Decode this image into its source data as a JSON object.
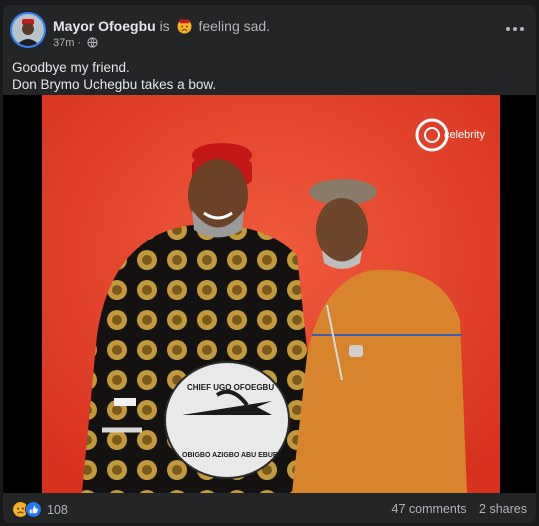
{
  "post": {
    "author": "Mayor Ofoegbu",
    "is_word": "is",
    "feeling": "feeling sad.",
    "time": "37m",
    "audience_icon": "globe-icon",
    "feeling_icon": "sad-face-emoji",
    "text_lines": [
      "Goodbye my friend.",
      "Don Brymo Uchegbu takes a bow."
    ]
  },
  "photo": {
    "watermark": "celebrity",
    "seal_text_top": "CHIEF UGO OFOEGBU",
    "seal_text_bottom": "OBIGBO AZIGBO ABU EBUBE"
  },
  "footer": {
    "reaction_icons": [
      "sad-reaction-icon",
      "like-reaction-icon"
    ],
    "reaction_count": "108",
    "comments": "47 comments",
    "shares": "2 shares"
  },
  "colors": {
    "card_bg": "#242526",
    "page_bg": "#18191a",
    "text_primary": "#e4e6eb",
    "text_secondary": "#b0b3b8",
    "photo_background": "#e8412c",
    "like_blue": "#2078f4",
    "sad_yellow": "#f7b125"
  }
}
